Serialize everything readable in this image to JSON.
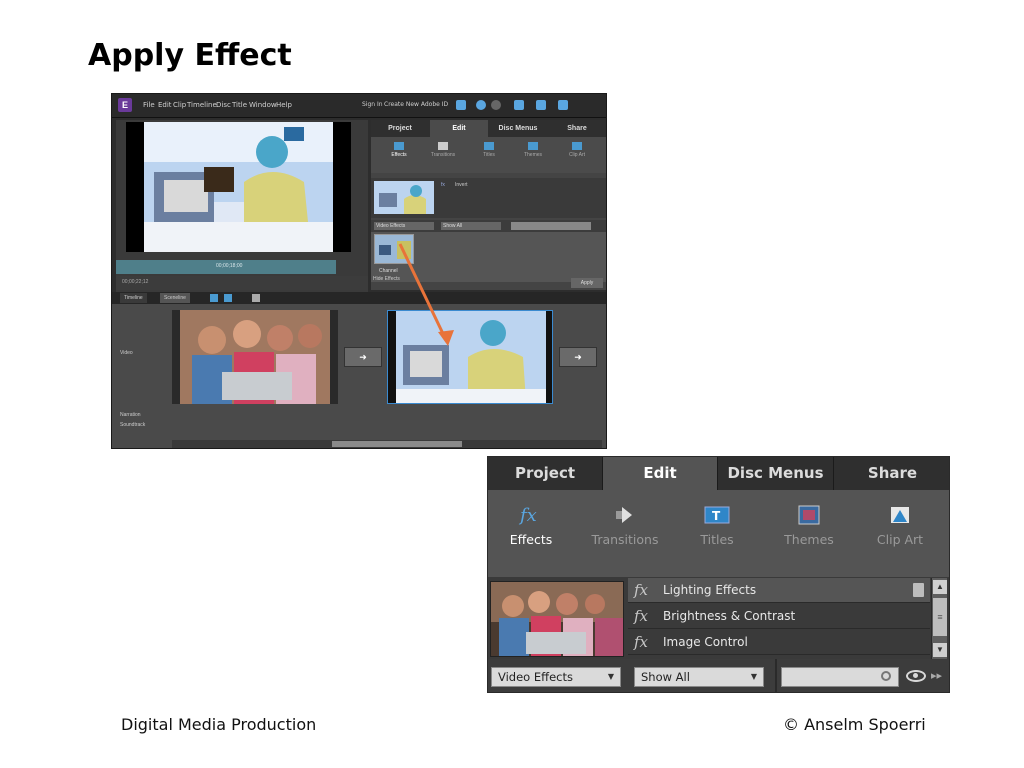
{
  "slide": {
    "title": "Apply Effect"
  },
  "app": {
    "menus": [
      "File",
      "Edit",
      "Clip",
      "Timeline",
      "Disc",
      "Title",
      "Window",
      "Help"
    ],
    "sign_in": "Sign In",
    "create_id": "Create New Adobe ID",
    "panel_tabs": [
      "Project",
      "Edit",
      "Disc Menus",
      "Share"
    ],
    "panel_tools": [
      "Effects",
      "Transitions",
      "Titles",
      "Themes",
      "Clip Art"
    ],
    "invert_label": "Invert",
    "video_effects": "Video Effects",
    "show_all": "Show All",
    "grid_item": "Channel",
    "hide_label": "Hide Effects",
    "apply_label": "Apply",
    "timeline_tabs": [
      "Timeline",
      "Sceneline"
    ],
    "tracks": [
      "Video",
      "Narration",
      "Soundtrack"
    ]
  },
  "panel": {
    "tabs": [
      "Project",
      "Edit",
      "Disc Menus",
      "Share"
    ],
    "active_tab": "Edit",
    "tools": [
      {
        "label": "Effects",
        "icon": "fx-icon"
      },
      {
        "label": "Transitions",
        "icon": "transitions-icon"
      },
      {
        "label": "Titles",
        "icon": "titles-icon"
      },
      {
        "label": "Themes",
        "icon": "themes-icon"
      },
      {
        "label": "Clip Art",
        "icon": "clip-art-icon"
      }
    ],
    "effects": [
      "Lighting Effects",
      "Brightness & Contrast",
      "Image Control"
    ],
    "category": "Video Effects",
    "filter": "Show All"
  },
  "footer": {
    "left": "Digital Media Production",
    "right": "© Anselm Spoerri"
  },
  "colors": {
    "accent_arrow": "#e8733a",
    "panel_bg": "#4e4e4e"
  }
}
